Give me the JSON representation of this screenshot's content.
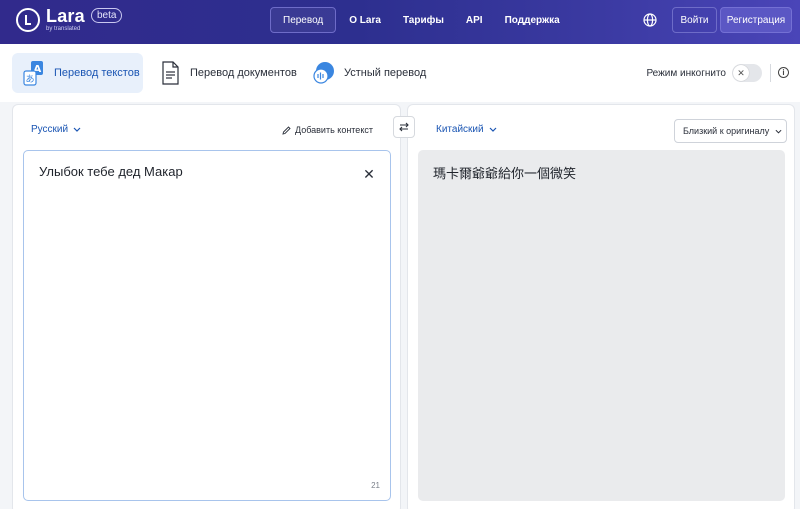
{
  "header": {
    "brand_name": "Lara",
    "brand_sub": "by translated",
    "badge": "beta",
    "nav": [
      {
        "label": "Перевод"
      },
      {
        "label": "O Lara"
      },
      {
        "label": "Тарифы"
      },
      {
        "label": "API"
      },
      {
        "label": "Поддержка"
      }
    ],
    "login_label": "Войти",
    "register_label": "Регистрация",
    "colors": {
      "accent": "#5b57c4",
      "bg_start": "#312a8c",
      "bg_end": "#4a45b8"
    }
  },
  "modes": {
    "tabs": [
      {
        "label": "Перевод текстов",
        "icon": "translate-text-icon",
        "active": true
      },
      {
        "label": "Перевод документов",
        "icon": "document-icon",
        "active": false
      },
      {
        "label": "Устный перевод",
        "icon": "voice-translation-icon",
        "active": false
      }
    ],
    "incognito_label": "Режим инкогнито",
    "incognito_on": false
  },
  "source": {
    "language": "Русский",
    "add_context_label": "Добавить контекст",
    "text": "Улыбок тебе дед Макар",
    "char_count": "21"
  },
  "target": {
    "language": "Китайский",
    "style_option": "Близкий к оригиналу",
    "text": "瑪卡爾爺爺給你一個微笑"
  },
  "colors": {
    "link": "#1a55b3",
    "active_tab_bg": "#e8f0fb",
    "output_bg": "#eaebed"
  }
}
